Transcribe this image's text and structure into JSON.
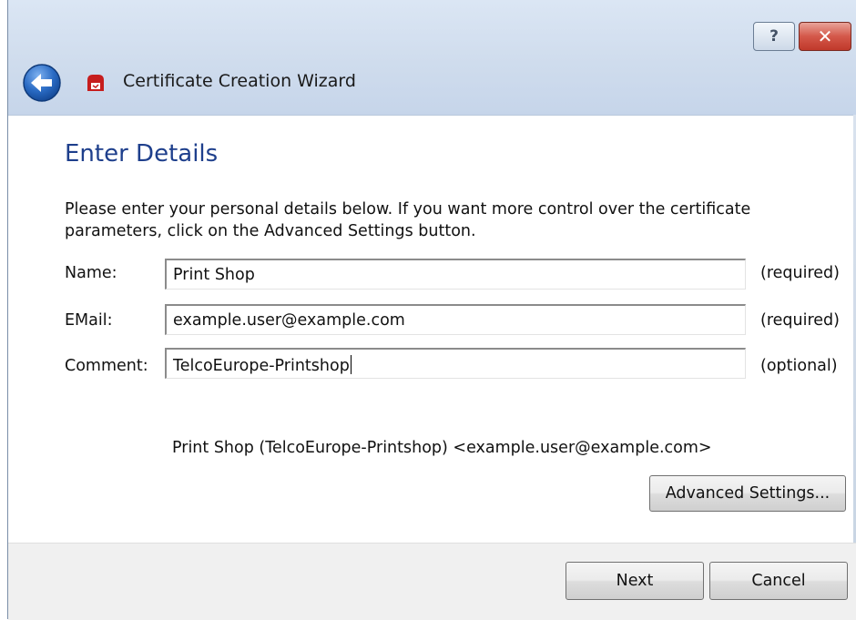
{
  "window": {
    "title": "Certificate Creation Wizard",
    "help_glyph": "?",
    "close_glyph": "✕"
  },
  "page": {
    "heading": "Enter Details",
    "intro": "Please enter your personal details below. If you want more control over the certificate parameters, click on the Advanced Settings button."
  },
  "fields": [
    {
      "label": "Name:",
      "value": "Print Shop",
      "note": "(required)"
    },
    {
      "label": "EMail:",
      "value": "example.user@example.com",
      "note": "(required)"
    },
    {
      "label": "Comment:",
      "value": "TelcoEurope-Printshop",
      "note": "(optional)"
    }
  ],
  "preview": "Print Shop (TelcoEurope-Printshop) <example.user@example.com>",
  "buttons": {
    "advanced": "Advanced Settings...",
    "next": "Next",
    "cancel": "Cancel"
  },
  "icons": {
    "back": "back-arrow-icon",
    "app": "certificate-app-icon"
  },
  "colors": {
    "heading": "#1e3f8c",
    "titlebar": "#cfdced",
    "close_button": "#c0392b",
    "back_button": "#2a6bc4",
    "footer": "#f0f0f0"
  }
}
